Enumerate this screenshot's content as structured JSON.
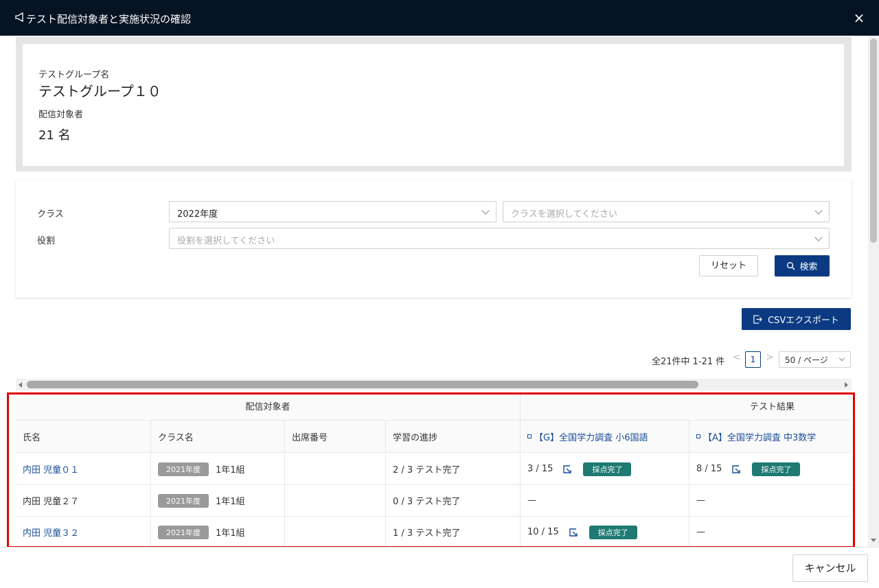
{
  "dialog": {
    "title": "テスト配信対象者と実施状況の確認",
    "close_label": "×"
  },
  "info": {
    "group_label": "テストグループ名",
    "group_value": "テストグループ１０",
    "target_label": "配信対象者",
    "target_value": "21 名"
  },
  "filters": {
    "class_label": "クラス",
    "year_value": "2022年度",
    "class_placeholder": "クラスを選択してください",
    "role_label": "役割",
    "role_placeholder": "役割を選択してください",
    "reset_label": "リセット",
    "search_label": "検索"
  },
  "export": {
    "csv_label": "CSVエクスポート"
  },
  "pager": {
    "total_text": "全21件中 1-21 件",
    "prev": "<",
    "page": "1",
    "next": ">",
    "page_size": "50 / ページ"
  },
  "table": {
    "groups": [
      "配信対象者",
      "テスト結果"
    ],
    "headers": [
      "氏名",
      "クラス名",
      "出席番号",
      "学習の進捗",
      "【G】全国学力調査 小6国語",
      "【A】全国学力調査 中3数学"
    ],
    "rows": [
      {
        "name": "内田 児童０１",
        "name_is_link": true,
        "year_tag": "2021年度",
        "class": "1年1組",
        "attendance": "",
        "progress": "2 / 3 テスト完了",
        "test1": {
          "score": "3 / 15",
          "status": "採点完了"
        },
        "test2": {
          "score": "8 / 15",
          "status": "採点完了"
        }
      },
      {
        "name": "内田 児童２７",
        "name_is_link": false,
        "year_tag": "2021年度",
        "class": "1年1組",
        "attendance": "",
        "progress": "0 / 3 テスト完了",
        "test1": {
          "score": "—",
          "status": ""
        },
        "test2": {
          "score": "—",
          "status": ""
        }
      },
      {
        "name": "内田 児童３２",
        "name_is_link": true,
        "year_tag": "2021年度",
        "class": "1年1組",
        "attendance": "",
        "progress": "1 / 3 テスト完了",
        "test1": {
          "score": "10 / 15",
          "status": "採点完了"
        },
        "test2": {
          "score": "—",
          "status": ""
        }
      }
    ]
  },
  "footer": {
    "cancel_label": "キャンセル"
  },
  "colors": {
    "titlebar": "#051323",
    "primary": "#0b3a82",
    "badge": "#1e7a72",
    "link": "#1a4c9a",
    "highlight": "#e00000"
  }
}
